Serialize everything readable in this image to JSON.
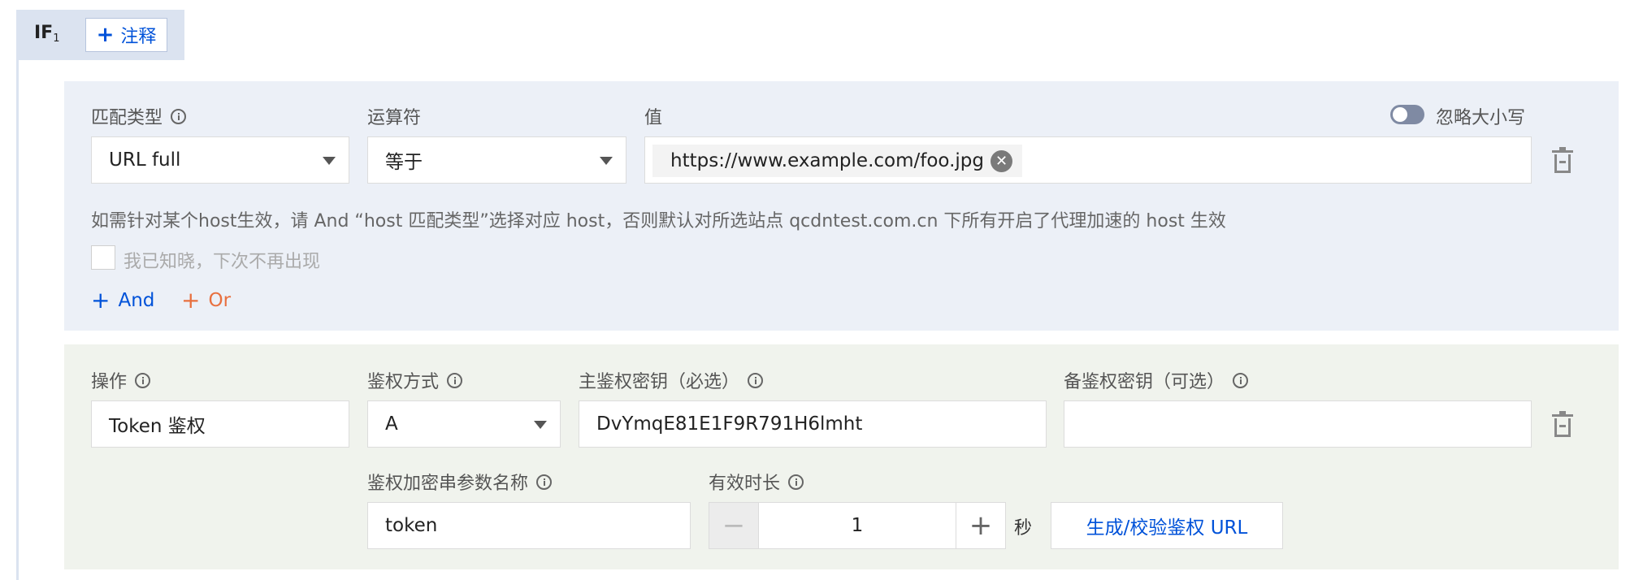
{
  "rule": {
    "if_label": "IF",
    "if_index": "1",
    "note_button": "注释"
  },
  "condition": {
    "match_type_label": "匹配类型",
    "match_type_value": "URL full",
    "operator_label": "运算符",
    "operator_value": "等于",
    "value_label": "值",
    "value_tag": "https://www.example.com/foo.jpg",
    "ignore_case_label": "忽略大小写",
    "ignore_case_on": false,
    "hint_text": "如需针对某个host生效，请 And “host 匹配类型”选择对应 host，否则默认对所选站点 qcdntest.com.cn 下所有开启了代理加速的 host 生效",
    "dismiss_label": "我已知晓，下次不再出现",
    "and_button": "And",
    "or_button": "Or"
  },
  "action": {
    "operation_label": "操作",
    "operation_value": "Token 鉴权",
    "auth_method_label": "鉴权方式",
    "auth_method_value": "A",
    "primary_key_label": "主鉴权密钥（必选）",
    "primary_key_value": "DvYmqE81E1F9R791H6lmht",
    "backup_key_label": "备鉴权密钥（可选）",
    "backup_key_value": "",
    "param_name_label": "鉴权加密串参数名称",
    "param_name_value": "token",
    "validity_label": "有效时长",
    "validity_value": "1",
    "validity_unit": "秒",
    "generate_button": "生成/校验鉴权 URL"
  },
  "colors": {
    "accent_blue": "#0052d9",
    "or_orange": "#e8703f",
    "condition_bg": "#ecf0f7",
    "action_bg": "#f0f3ed"
  }
}
